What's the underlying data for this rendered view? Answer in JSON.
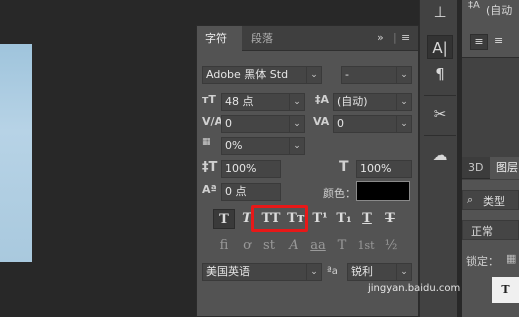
{
  "panel": {
    "tabs": [
      "字符",
      "段落"
    ],
    "collapse_label": "»",
    "font_family": "Adobe 黑体 Std",
    "font_style": "-",
    "font_size": "48 点",
    "leading": "(自动)",
    "kerning": "0",
    "tracking": "0",
    "tsume": "0%",
    "vertical_scale": "100%",
    "horizontal_scale": "100%",
    "baseline_shift": "0 点",
    "color_label": "颜色：",
    "color_value": "#000000",
    "type_buttons": [
      "T",
      "T",
      "TT",
      "Tт",
      "T¹",
      "T₁",
      "T",
      "T"
    ],
    "opentype_buttons": [
      "fi",
      "ơ",
      "st",
      "A",
      "aa",
      "T",
      "1st",
      "½"
    ],
    "language": "美国英语",
    "aa_label": "ªa",
    "antialias": "锐利"
  },
  "right_panel": {
    "top_text": "(自动",
    "tab_3d": "3D",
    "tab_layers": "图层",
    "search_kind": "类型",
    "blend_mode": "正常",
    "lock_label": "锁定："
  },
  "watermark": "jingyan.baidu.com",
  "colors": {
    "highlight": "#e81818",
    "panel_bg": "#535353"
  }
}
